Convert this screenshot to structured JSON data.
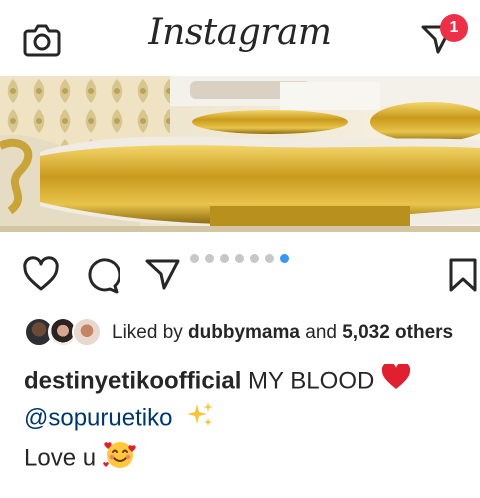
{
  "header": {
    "logo_text": "Instagram",
    "camera_icon": "camera-icon",
    "dm_icon": "direct-message-icon",
    "dm_badge_count": "1",
    "badge_color": "#ed2f48"
  },
  "post": {
    "media_description_icon": "gold-furniture-photo",
    "carousel": {
      "total": 7,
      "active_index": 6,
      "active_color": "#3897f0"
    },
    "actions": {
      "like_icon": "heart-icon",
      "comment_icon": "comment-icon",
      "share_icon": "send-icon",
      "save_icon": "bookmark-icon"
    },
    "likes": {
      "prefix": "Liked by ",
      "user": "dubbymama",
      "connector": " and ",
      "others": "5,032 others"
    },
    "caption": {
      "username": "destinyetikoofficial",
      "line1_text": " MY BLOOD ",
      "mention": "@sopuruetiko",
      "line3_text": "Love u "
    }
  }
}
